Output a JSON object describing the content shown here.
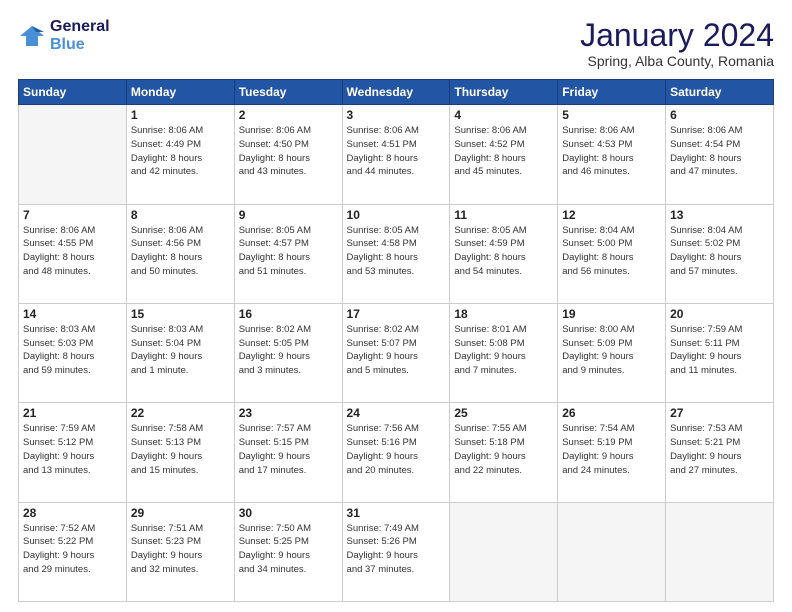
{
  "logo": {
    "line1": "General",
    "line2": "Blue"
  },
  "header": {
    "title": "January 2024",
    "subtitle": "Spring, Alba County, Romania"
  },
  "weekdays": [
    "Sunday",
    "Monday",
    "Tuesday",
    "Wednesday",
    "Thursday",
    "Friday",
    "Saturday"
  ],
  "weeks": [
    [
      {
        "day": "",
        "info": ""
      },
      {
        "day": "1",
        "info": "Sunrise: 8:06 AM\nSunset: 4:49 PM\nDaylight: 8 hours\nand 42 minutes."
      },
      {
        "day": "2",
        "info": "Sunrise: 8:06 AM\nSunset: 4:50 PM\nDaylight: 8 hours\nand 43 minutes."
      },
      {
        "day": "3",
        "info": "Sunrise: 8:06 AM\nSunset: 4:51 PM\nDaylight: 8 hours\nand 44 minutes."
      },
      {
        "day": "4",
        "info": "Sunrise: 8:06 AM\nSunset: 4:52 PM\nDaylight: 8 hours\nand 45 minutes."
      },
      {
        "day": "5",
        "info": "Sunrise: 8:06 AM\nSunset: 4:53 PM\nDaylight: 8 hours\nand 46 minutes."
      },
      {
        "day": "6",
        "info": "Sunrise: 8:06 AM\nSunset: 4:54 PM\nDaylight: 8 hours\nand 47 minutes."
      }
    ],
    [
      {
        "day": "7",
        "info": "Sunrise: 8:06 AM\nSunset: 4:55 PM\nDaylight: 8 hours\nand 48 minutes."
      },
      {
        "day": "8",
        "info": "Sunrise: 8:06 AM\nSunset: 4:56 PM\nDaylight: 8 hours\nand 50 minutes."
      },
      {
        "day": "9",
        "info": "Sunrise: 8:05 AM\nSunset: 4:57 PM\nDaylight: 8 hours\nand 51 minutes."
      },
      {
        "day": "10",
        "info": "Sunrise: 8:05 AM\nSunset: 4:58 PM\nDaylight: 8 hours\nand 53 minutes."
      },
      {
        "day": "11",
        "info": "Sunrise: 8:05 AM\nSunset: 4:59 PM\nDaylight: 8 hours\nand 54 minutes."
      },
      {
        "day": "12",
        "info": "Sunrise: 8:04 AM\nSunset: 5:00 PM\nDaylight: 8 hours\nand 56 minutes."
      },
      {
        "day": "13",
        "info": "Sunrise: 8:04 AM\nSunset: 5:02 PM\nDaylight: 8 hours\nand 57 minutes."
      }
    ],
    [
      {
        "day": "14",
        "info": "Sunrise: 8:03 AM\nSunset: 5:03 PM\nDaylight: 8 hours\nand 59 minutes."
      },
      {
        "day": "15",
        "info": "Sunrise: 8:03 AM\nSunset: 5:04 PM\nDaylight: 9 hours\nand 1 minute."
      },
      {
        "day": "16",
        "info": "Sunrise: 8:02 AM\nSunset: 5:05 PM\nDaylight: 9 hours\nand 3 minutes."
      },
      {
        "day": "17",
        "info": "Sunrise: 8:02 AM\nSunset: 5:07 PM\nDaylight: 9 hours\nand 5 minutes."
      },
      {
        "day": "18",
        "info": "Sunrise: 8:01 AM\nSunset: 5:08 PM\nDaylight: 9 hours\nand 7 minutes."
      },
      {
        "day": "19",
        "info": "Sunrise: 8:00 AM\nSunset: 5:09 PM\nDaylight: 9 hours\nand 9 minutes."
      },
      {
        "day": "20",
        "info": "Sunrise: 7:59 AM\nSunset: 5:11 PM\nDaylight: 9 hours\nand 11 minutes."
      }
    ],
    [
      {
        "day": "21",
        "info": "Sunrise: 7:59 AM\nSunset: 5:12 PM\nDaylight: 9 hours\nand 13 minutes."
      },
      {
        "day": "22",
        "info": "Sunrise: 7:58 AM\nSunset: 5:13 PM\nDaylight: 9 hours\nand 15 minutes."
      },
      {
        "day": "23",
        "info": "Sunrise: 7:57 AM\nSunset: 5:15 PM\nDaylight: 9 hours\nand 17 minutes."
      },
      {
        "day": "24",
        "info": "Sunrise: 7:56 AM\nSunset: 5:16 PM\nDaylight: 9 hours\nand 20 minutes."
      },
      {
        "day": "25",
        "info": "Sunrise: 7:55 AM\nSunset: 5:18 PM\nDaylight: 9 hours\nand 22 minutes."
      },
      {
        "day": "26",
        "info": "Sunrise: 7:54 AM\nSunset: 5:19 PM\nDaylight: 9 hours\nand 24 minutes."
      },
      {
        "day": "27",
        "info": "Sunrise: 7:53 AM\nSunset: 5:21 PM\nDaylight: 9 hours\nand 27 minutes."
      }
    ],
    [
      {
        "day": "28",
        "info": "Sunrise: 7:52 AM\nSunset: 5:22 PM\nDaylight: 9 hours\nand 29 minutes."
      },
      {
        "day": "29",
        "info": "Sunrise: 7:51 AM\nSunset: 5:23 PM\nDaylight: 9 hours\nand 32 minutes."
      },
      {
        "day": "30",
        "info": "Sunrise: 7:50 AM\nSunset: 5:25 PM\nDaylight: 9 hours\nand 34 minutes."
      },
      {
        "day": "31",
        "info": "Sunrise: 7:49 AM\nSunset: 5:26 PM\nDaylight: 9 hours\nand 37 minutes."
      },
      {
        "day": "",
        "info": ""
      },
      {
        "day": "",
        "info": ""
      },
      {
        "day": "",
        "info": ""
      }
    ]
  ]
}
